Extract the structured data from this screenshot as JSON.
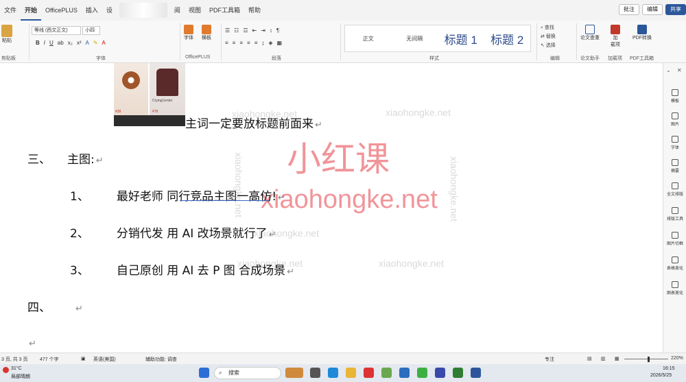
{
  "menu": {
    "tabs": [
      "文件",
      "开始",
      "OfficePLUS",
      "插入",
      "设",
      "阅",
      "视图",
      "PDF工具箱",
      "帮助"
    ],
    "active": "开始",
    "comment_btn": "批注",
    "edit_btn": "编辑",
    "share_btn": "共享"
  },
  "ribbon": {
    "paste": "粘贴",
    "clipboard_label": "剪贴板",
    "font_name": "等线 (西文正文)",
    "font_size": "小四",
    "font_label": "字体",
    "font_btn": "字体",
    "horizontal_btn": "横板",
    "officeplus_label": "OfficePLUS",
    "paragraph_label": "段落",
    "styles": [
      "正文",
      "无间隔",
      "标题 1",
      "标题 2"
    ],
    "styles_label": "样式",
    "find": "查找",
    "replace": "替换",
    "select": "选择",
    "editing_label": "编辑",
    "paper_check": "论文查重",
    "paper_label": "论文助手",
    "addin": "加\n载项",
    "addin_label": "加载项",
    "pdf_convert": "PDF转换",
    "pdf_label": "PDF工具箱"
  },
  "doc": {
    "thumb_caption1": "CryingCenter",
    "thumb_price1": "¥38",
    "thumb_price2": "¥78",
    "line0": "主词一定要放标题前面来",
    "line1_num": "三、",
    "line1_text": "主图:",
    "line2_num": "1、",
    "line2_text": "最好老师  同行竞品主图一高仿!",
    "line3_num": "2、",
    "line3_text": "分销代发  用 AI 改场景就行了",
    "line4_num": "3、",
    "line4_text": "自己原创    用 AI 去 P 图    合成场景",
    "line5_num": "四、",
    "watermark": "xiaohongke.net",
    "watermark_cn": "小红课"
  },
  "pane": {
    "items": [
      "模板",
      "图片",
      "字体",
      "摘要",
      "全文排版",
      "排版工具",
      "图片切框",
      "表格美化",
      "图表美化"
    ]
  },
  "status": {
    "pages": "3 页, 共 3 页",
    "words": "477 个字",
    "lang": "英语(美国)",
    "access": "辅助功能: 调查",
    "focus": "专注",
    "zoom": "220%"
  },
  "taskbar": {
    "temp": "31°C",
    "weather": "局部晴朗",
    "search": "搜索",
    "time": "16:15",
    "date": "2026/5/25"
  }
}
